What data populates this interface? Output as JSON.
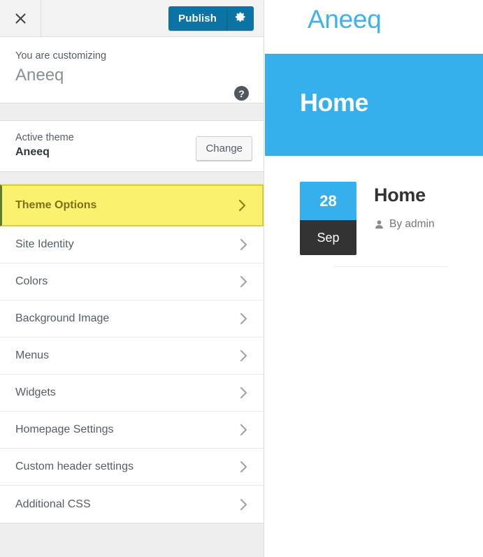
{
  "customizer": {
    "close_icon": "close-x-icon",
    "publish_label": "Publish",
    "gear_icon": "gear-icon",
    "info_label": "You are customizing",
    "info_title": "Aneeq",
    "help_icon": "?",
    "theme_label": "Active theme",
    "theme_name": "Aneeq",
    "change_label": "Change",
    "panels": [
      {
        "label": "Theme Options",
        "highlighted": true
      },
      {
        "label": "Site Identity",
        "highlighted": false
      },
      {
        "label": "Colors",
        "highlighted": false
      },
      {
        "label": "Background Image",
        "highlighted": false
      },
      {
        "label": "Menus",
        "highlighted": false
      },
      {
        "label": "Widgets",
        "highlighted": false
      },
      {
        "label": "Homepage Settings",
        "highlighted": false
      },
      {
        "label": "Custom header settings",
        "highlighted": false
      },
      {
        "label": "Additional CSS",
        "highlighted": false
      }
    ]
  },
  "preview": {
    "site_title": "Aneeq",
    "hero_title": "Home",
    "post": {
      "date_day": "28",
      "date_month": "Sep",
      "title": "Home",
      "author_icon": "user-icon",
      "author_text": "By admin"
    }
  },
  "colors": {
    "accent_blue": "#36b0ec",
    "publish_blue": "#0c74a4",
    "highlight_yellow": "#faf26e",
    "highlight_border": "#d6d42a",
    "dark_badge": "#333333"
  }
}
